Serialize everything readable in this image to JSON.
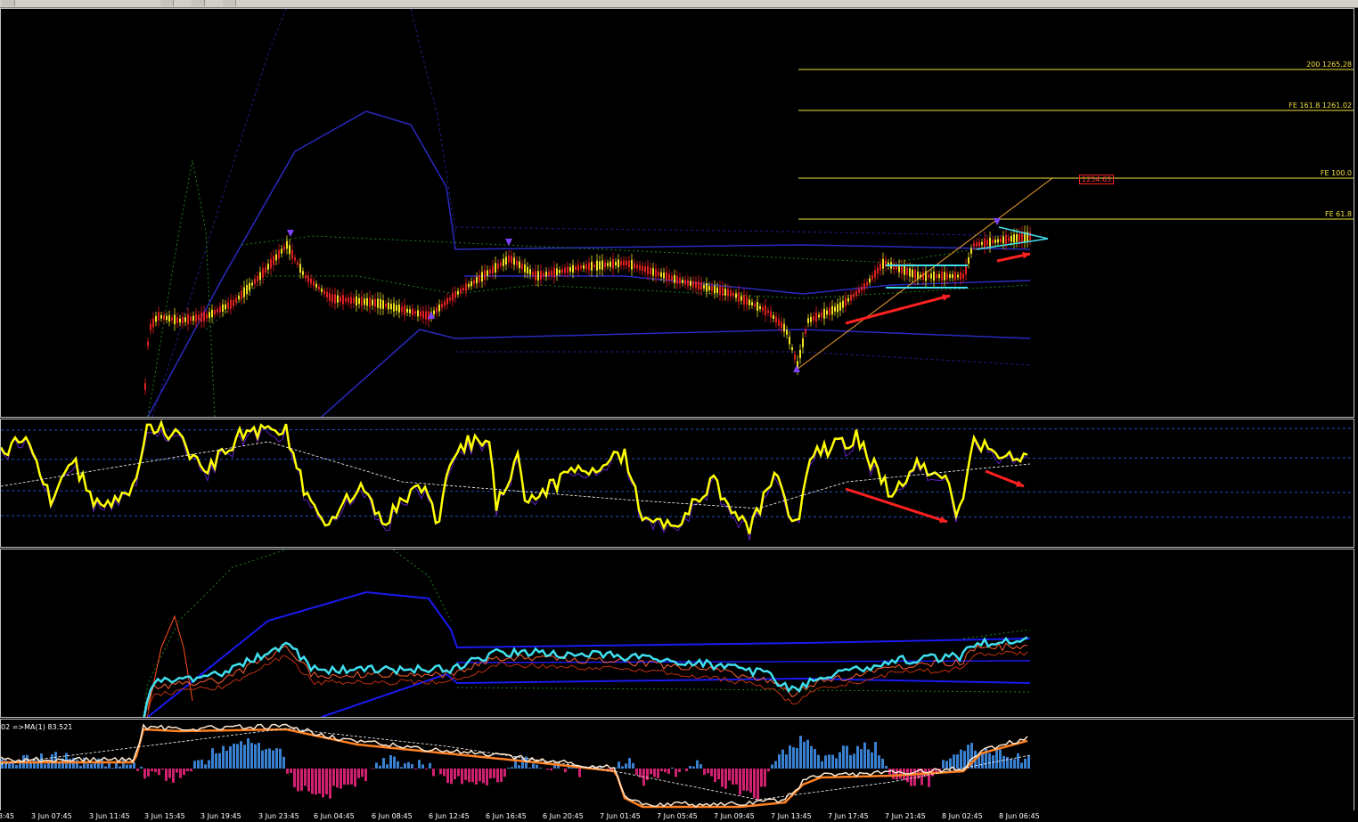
{
  "toolbar": {
    "items": [
      "toolbar-btn-1",
      "toolbar-btn-2",
      "toolbar-btn-3",
      "toolbar-btn-4"
    ]
  },
  "fib_levels": [
    {
      "label": "200 1265.28"
    },
    {
      "label": "FE 161.8 1261.02"
    },
    {
      "label": "FE 100.0"
    },
    {
      "label": "FE 61.8"
    }
  ],
  "price_tag": "1254.63",
  "macd": {
    "label": "02  =>MA(1) 83.521"
  },
  "x_axis_labels": [
    "3:45",
    "3 Jun 07:45",
    "3 Jun 11:45",
    "3 Jun 15:45",
    "3 Jun 19:45",
    "3 Jun 23:45",
    "6 Jun 04:45",
    "6 Jun 08:45",
    "6 Jun 12:45",
    "6 Jun 16:45",
    "6 Jun 20:45",
    "7 Jun 01:45",
    "7 Jun 05:45",
    "7 Jun 09:45",
    "7 Jun 13:45",
    "7 Jun 17:45",
    "7 Jun 21:45",
    "8 Jun 02:45",
    "8 Jun 06:45"
  ],
  "colors": {
    "candle_up": "#f0e020",
    "candle_down": "#e02020",
    "band": "#2a2ac0",
    "oscillator": "#ffff00",
    "cyan_line": "#40e0f0",
    "fib": "#f0e040",
    "arrow": "#ff2020",
    "hist_pos": "#3a80d0",
    "hist_neg": "#d02070"
  }
}
